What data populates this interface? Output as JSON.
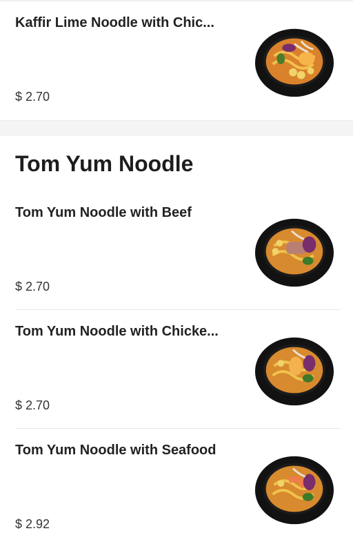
{
  "items_top": [
    {
      "title": "Kaffir Lime Noodle with Chic...",
      "price": "$ 2.70",
      "image": "bowl-with-chicken-noodles"
    }
  ],
  "section": {
    "title": "Tom Yum Noodle",
    "items": [
      {
        "title": "Tom Yum Noodle with Beef",
        "price": "$ 2.70",
        "image": "bowl-with-beef-noodles"
      },
      {
        "title": "Tom Yum Noodle with Chicke...",
        "price": "$ 2.70",
        "image": "bowl-with-chicken-noodles"
      },
      {
        "title": "Tom Yum Noodle with Seafood",
        "price": "$ 2.92",
        "image": "bowl-with-seafood-noodles"
      }
    ]
  }
}
